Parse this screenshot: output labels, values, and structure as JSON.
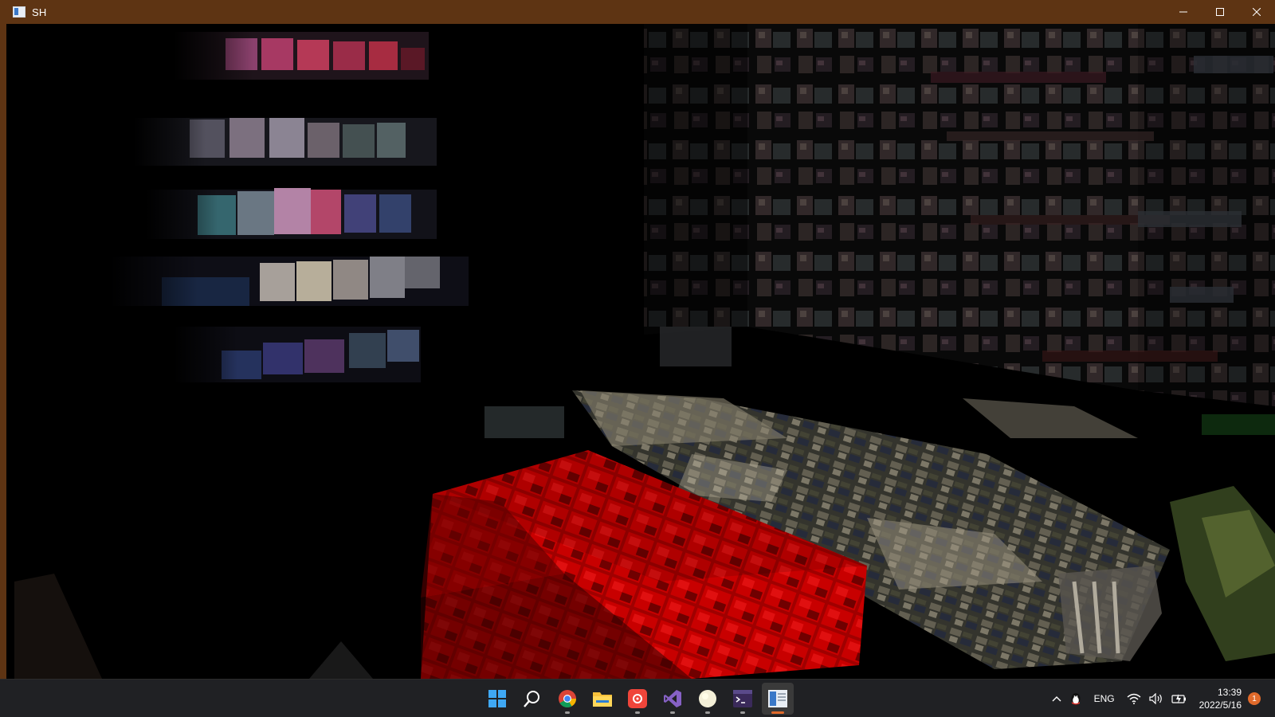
{
  "window": {
    "title": "SH",
    "controls": [
      "minimize",
      "maximize",
      "close"
    ]
  },
  "viewport": {
    "scene": "dark store interior with shelves of goods and a red crate"
  },
  "taskbar": {
    "apps": [
      {
        "name": "start",
        "icon": "windows-start-icon",
        "running": false
      },
      {
        "name": "search",
        "icon": "search-icon",
        "running": false
      },
      {
        "name": "chrome",
        "icon": "chrome-icon",
        "running": true
      },
      {
        "name": "file-explorer",
        "icon": "folder-icon",
        "running": false
      },
      {
        "name": "app-red",
        "icon": "red-app-icon",
        "running": true
      },
      {
        "name": "visual-studio",
        "icon": "visual-studio-icon",
        "running": true
      },
      {
        "name": "app-light",
        "icon": "white-circle-app-icon",
        "running": true
      },
      {
        "name": "terminal",
        "icon": "terminal-icon",
        "running": true
      },
      {
        "name": "sh-game",
        "icon": "game-window-icon",
        "running": true,
        "active": true
      }
    ],
    "tray": {
      "language": "ENG",
      "time": "13:39",
      "date": "2022/5/16",
      "notification_count": "1"
    }
  },
  "colors": {
    "titlebar": "#5e3413",
    "taskbar": "#202124",
    "accent": "#e06a2b"
  }
}
